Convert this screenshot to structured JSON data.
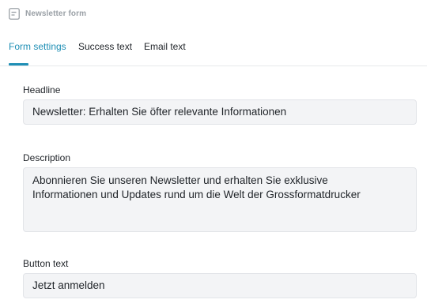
{
  "header": {
    "icon": "form-icon",
    "title": "Newsletter form"
  },
  "tabs": [
    {
      "label": "Form settings",
      "active": true
    },
    {
      "label": "Success text",
      "active": false
    },
    {
      "label": "Email text",
      "active": false
    }
  ],
  "accent_color": "#1f8fb5",
  "form": {
    "headline": {
      "label": "Headline",
      "value": "Newsletter: Erhalten Sie öfter relevante Informationen"
    },
    "description": {
      "label": "Description",
      "value": "Abonnieren Sie unseren Newsletter und erhalten Sie exklusive\nInformationen und Updates rund um die Welt der Grossformatdrucker"
    },
    "button_text": {
      "label": "Button text",
      "value": "Jetzt anmelden"
    }
  }
}
